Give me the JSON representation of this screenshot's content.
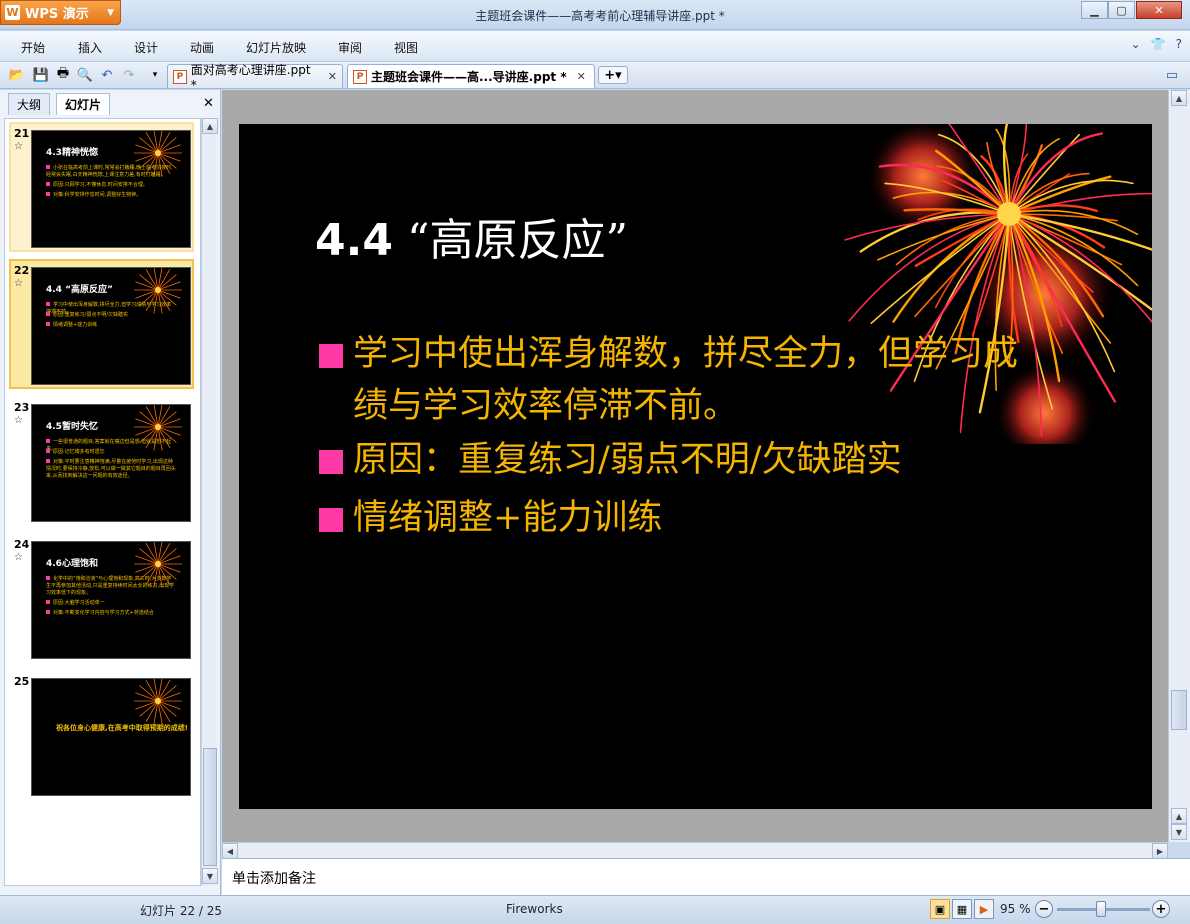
{
  "app": {
    "name": "WPS 演示",
    "window_title": "主题班会课件——高考考前心理辅导讲座.ppt *"
  },
  "menu": [
    "开始",
    "插入",
    "设计",
    "动画",
    "幻灯片放映",
    "审阅",
    "视图"
  ],
  "doc_tabs": [
    {
      "label": "面对高考心理讲座.ppt *"
    },
    {
      "label": "主题班会课件——高...导讲座.ppt *"
    }
  ],
  "panel_tabs": [
    "大纲",
    "幻灯片"
  ],
  "thumbnails": [
    {
      "num": "21",
      "title": "4.3精神恍惚",
      "bullets": [
        "小张在临高考前上课时,常常会打瞌睡,晚上临考前夜时,经常会失眠,白天精神恍惚,上课注意力差,有时打瞌睡。",
        "原因:只顾学习,不懂休息,时间安排不合理。",
        "对策:科学安排作息时间,调整好生物钟。"
      ]
    },
    {
      "num": "22",
      "title": "4.4 “高原反应”",
      "bullets": [
        "学习中使出浑身解数,拼尽全力,但学习成绩与学习效率停滞不前。",
        "原因:重复练习/弱点不明/欠缺踏实",
        "情绪调整+能力训练"
      ]
    },
    {
      "num": "23",
      "title": "4.5暂时失忆",
      "bullets": [
        "一些很普通的题目,答案就在嘴边但是想,但就是想不起来。",
        "原因:记忆博多有时遗忘",
        "对策:平时要注意精神饱满,尽量在疲劳时学习,出现这种情况时,要保持冷静,放松,可以做一做其它题目的题目再回头来,从而找到解决这一问题的有效途径。"
      ]
    },
    {
      "num": "24",
      "title": "4.6心理饱和",
      "bullets": [
        "化学中的“饱和溶液”与心理饱和现象,高三时,大多数学生不再参加其他活动,只是重复持续时间太长的练习,出现学习效率低下的现象。",
        "原因:大脑学习活动单一",
        "对策:不断变化学习内容与学习方式+劳逸结合"
      ]
    },
    {
      "num": "25",
      "closing": "祝各位身心健康,在高考中取得预期的成绩!"
    }
  ],
  "slide": {
    "title_num": "4.4",
    "title_text": "“高原反应”",
    "bullets": [
      "学习中使出浑身解数，拼尽全力，但学习成绩与学习效率停滞不前。",
      "原因：重复练习/弱点不明/欠缺踏实",
      "情绪调整+能力训练"
    ]
  },
  "notes_placeholder": "单击添加备注",
  "status": {
    "slide_info": "幻灯片 22 / 25",
    "theme": "Fireworks",
    "zoom": "95 %",
    "zoom_fraction": 0.95
  },
  "colors": {
    "accent_bullet": "#ff3aa6",
    "body_text": "#f4b400",
    "slide_bg": "#000000"
  }
}
